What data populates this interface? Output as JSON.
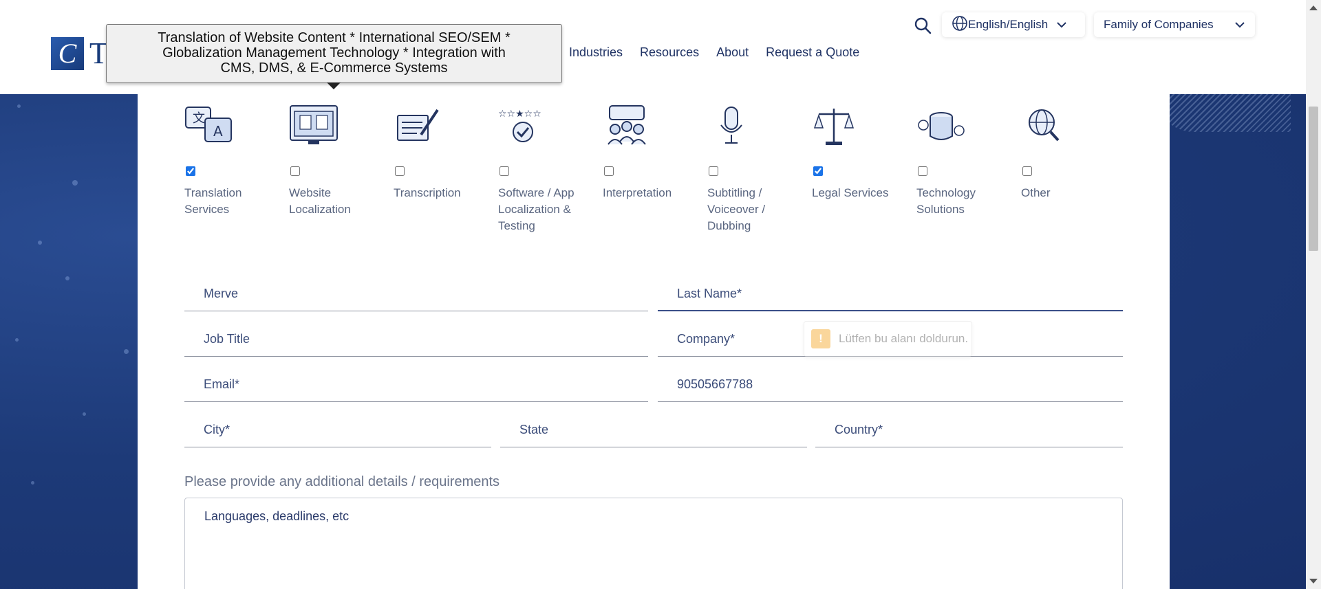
{
  "header": {
    "logo_letter": "C",
    "logo_partial_text": "T",
    "nav": [
      "Industries",
      "Resources",
      "About",
      "Request a Quote"
    ],
    "language_selector": "English/English",
    "family_selector": "Family of Companies"
  },
  "tooltip": {
    "line1": "Translation of Website Content  *  International SEO/SEM  *",
    "line2": "Globalization Management Technology  *  Integration with",
    "line3": "CMS, DMS, & E-Commerce Systems"
  },
  "services": [
    {
      "label": "Translation Services",
      "checked": true,
      "icon": "translation-icon"
    },
    {
      "label": "Website Localization",
      "checked": false,
      "icon": "website-localization-icon"
    },
    {
      "label": "Transcription",
      "checked": false,
      "icon": "transcription-icon"
    },
    {
      "label": "Software / App Localization & Testing",
      "checked": false,
      "icon": "software-rating-icon"
    },
    {
      "label": "Interpretation",
      "checked": false,
      "icon": "interpretation-icon"
    },
    {
      "label": "Subtitling / Voiceover / Dubbing",
      "checked": false,
      "icon": "microphone-icon"
    },
    {
      "label": "Legal Services",
      "checked": true,
      "icon": "scales-icon"
    },
    {
      "label": "Technology Solutions",
      "checked": false,
      "icon": "database-icon"
    },
    {
      "label": "Other",
      "checked": false,
      "icon": "globe-search-icon"
    }
  ],
  "form": {
    "first_name_value": "Merve",
    "last_name_placeholder": "Last Name*",
    "job_title_placeholder": "Job Title",
    "company_placeholder": "Company*",
    "email_placeholder": "Email*",
    "phone_value": "90505667788",
    "city_placeholder": "City*",
    "state_placeholder": "State",
    "country_placeholder": "Country*",
    "validation_message": "Lütfen bu alanı doldurun.",
    "details_label": "Please provide any additional details / requirements",
    "details_placeholder": "Languages, deadlines, etc"
  },
  "colors": {
    "navy": "#1f3264",
    "background_blue": "#1d3a78",
    "checkbox_blue": "#1a73e8"
  }
}
